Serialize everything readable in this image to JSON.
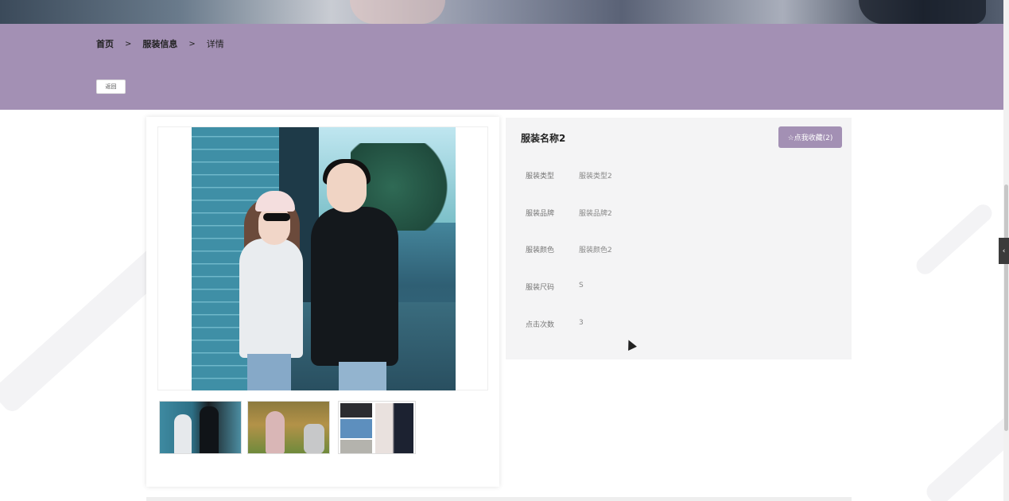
{
  "breadcrumb": {
    "home": "首页",
    "separator_1": ">",
    "category": "服装信息",
    "separator_2": ">",
    "current": "详情"
  },
  "header": {
    "back_label": "返回",
    "accent_color": "#a390b4"
  },
  "gallery": {
    "main_image_icon": "couple-photo",
    "thumbnails": [
      "couple-photo-thumb",
      "garden-photo-thumb",
      "wedding-collage-thumb"
    ]
  },
  "details": {
    "title": "服装名称2",
    "favorite_label": "☆点我收藏(2)",
    "rows": [
      {
        "label": "服装类型",
        "value": "服装类型2"
      },
      {
        "label": "服装品牌",
        "value": "服装品牌2"
      },
      {
        "label": "服装颜色",
        "value": "服装颜色2"
      },
      {
        "label": "服装尺码",
        "value": "S"
      },
      {
        "label": "点击次数",
        "value": "3"
      }
    ]
  },
  "side_tab": {
    "icon": "chevron-left-icon",
    "glyph": "‹"
  }
}
